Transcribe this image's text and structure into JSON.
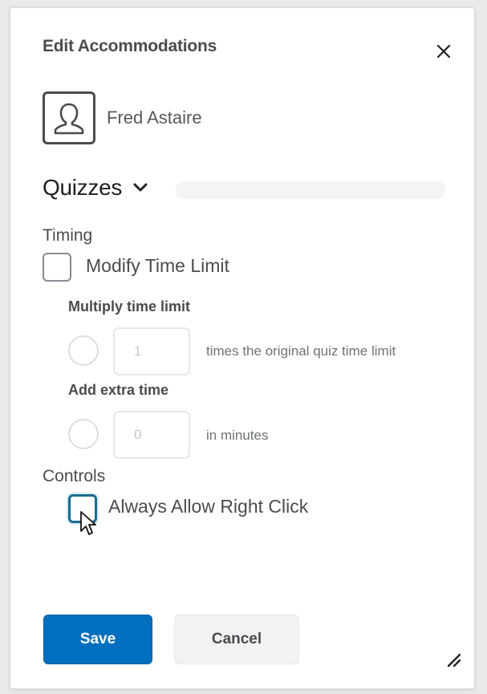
{
  "dialog": {
    "title": "Edit Accommodations",
    "close_icon": "close-icon"
  },
  "user": {
    "name": "Fred Astaire",
    "avatar_icon": "user-silhouette-icon"
  },
  "section": {
    "title": "Quizzes",
    "expanded": true,
    "chevron_icon": "chevron-down-icon"
  },
  "timing": {
    "label": "Timing",
    "modify_time_limit": {
      "label": "Modify Time Limit",
      "checked": false
    },
    "multiply": {
      "label": "Multiply time limit",
      "value": "1",
      "suffix": "times the original quiz time limit",
      "selected": false
    },
    "extra": {
      "label": "Add extra time",
      "value": "0",
      "suffix": "in minutes",
      "selected": false
    }
  },
  "controls": {
    "label": "Controls",
    "always_allow_right_click": {
      "label": "Always Allow Right Click",
      "checked": false,
      "focused": true
    }
  },
  "footer": {
    "save_label": "Save",
    "cancel_label": "Cancel"
  },
  "colors": {
    "primary": "#006fbf",
    "focus": "#1b6b91",
    "text": "#494c4e"
  }
}
